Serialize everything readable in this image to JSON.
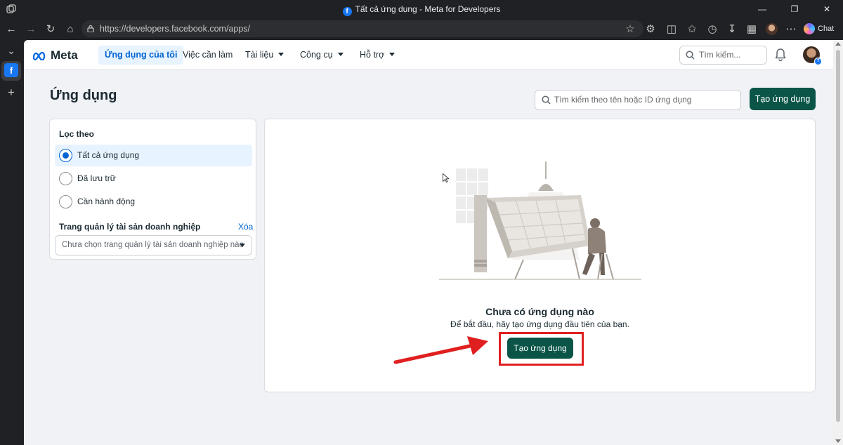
{
  "browser": {
    "window_title": "Tất cả ứng dụng - Meta for Developers",
    "url": "https://developers.facebook.com/apps/",
    "chat_label": "Chat"
  },
  "topnav": {
    "brand": "Meta",
    "items": [
      {
        "label": "Ứng dụng của tôi",
        "active": true
      },
      {
        "label": "Việc cần làm",
        "active": false
      },
      {
        "label": "Tài liệu",
        "dropdown": true
      },
      {
        "label": "Công cụ",
        "dropdown": true
      },
      {
        "label": "Hỗ trợ",
        "dropdown": true
      }
    ],
    "search_placeholder": "Tìm kiếm..."
  },
  "page": {
    "title": "Ứng dụng",
    "app_search_placeholder": "Tìm kiếm theo tên hoặc ID ứng dụng",
    "create_button": "Tạo ứng dụng"
  },
  "filter": {
    "title": "Lọc theo",
    "options": [
      {
        "label": "Tất cả ứng dụng",
        "selected": true
      },
      {
        "label": "Đã lưu trữ",
        "selected": false
      },
      {
        "label": "Cần hành động",
        "selected": false
      }
    ],
    "business_manager_label": "Trang quản lý tài sản doanh nghiệp",
    "clear_label": "Xóa",
    "business_manager_placeholder": "Chưa chọn trang quản lý tài sản doanh nghiệp nào"
  },
  "empty_state": {
    "title": "Chưa có ứng dụng nào",
    "subtitle": "Để bắt đầu, hãy tạo ứng dụng đầu tiên của bạn.",
    "button": "Tạo ứng dụng"
  },
  "colors": {
    "primary_button": "#0a5547",
    "link": "#0064d1",
    "highlight": "#e02020",
    "facebook_blue": "#1877f2"
  }
}
